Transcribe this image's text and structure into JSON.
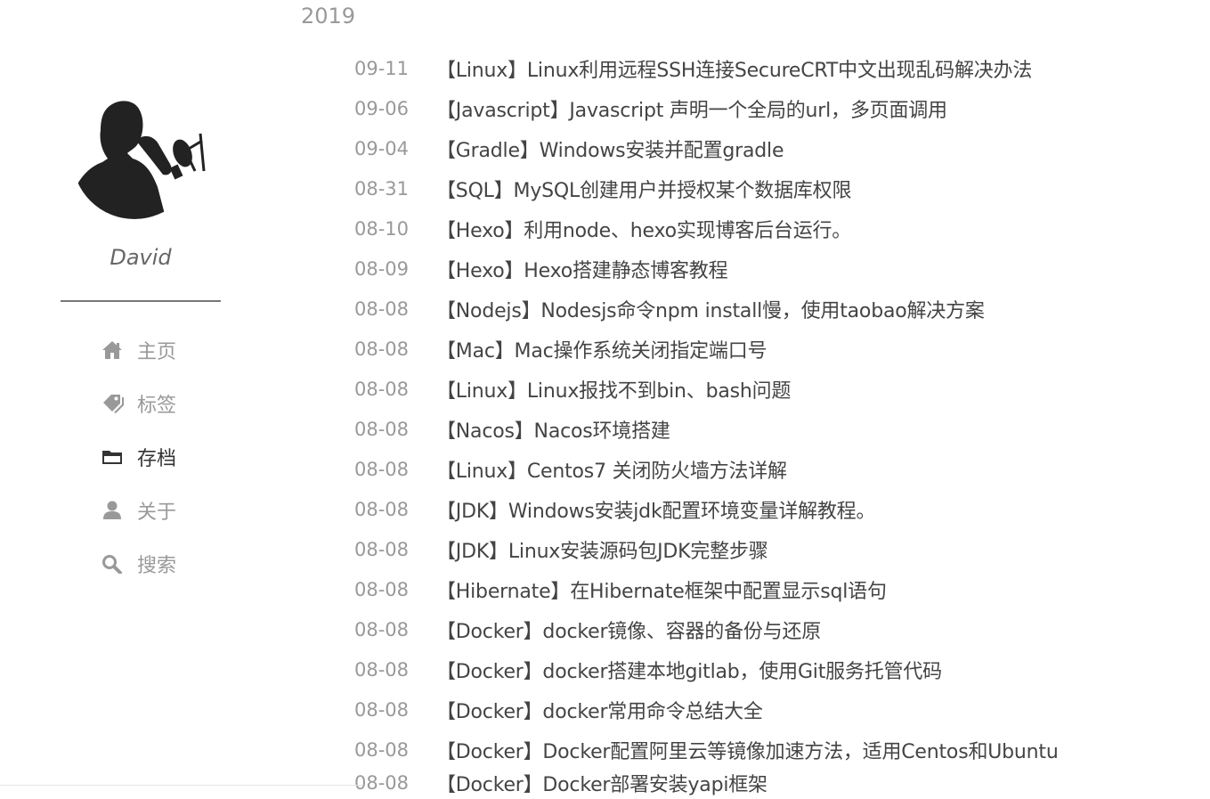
{
  "sidebar": {
    "author": "David",
    "nav": [
      {
        "label": "主页",
        "icon": "home-icon",
        "active": false
      },
      {
        "label": "标签",
        "icon": "tag-icon",
        "active": false
      },
      {
        "label": "存档",
        "icon": "archive-folder-icon",
        "active": true
      },
      {
        "label": "关于",
        "icon": "user-icon",
        "active": false
      },
      {
        "label": "搜索",
        "icon": "search-icon",
        "active": false
      }
    ]
  },
  "archive": {
    "year": "2019",
    "posts": [
      {
        "date": "09-11",
        "title": "【Linux】Linux利用远程SSH连接SecureCRT中文出现乱码解决办法"
      },
      {
        "date": "09-06",
        "title": "【Javascript】Javascript 声明一个全局的url，多页面调用"
      },
      {
        "date": "09-04",
        "title": "【Gradle】Windows安装并配置gradle"
      },
      {
        "date": "08-31",
        "title": "【SQL】MySQL创建用户并授权某个数据库权限"
      },
      {
        "date": "08-10",
        "title": "【Hexo】利用node、hexo实现博客后台运行。"
      },
      {
        "date": "08-09",
        "title": "【Hexo】Hexo搭建静态博客教程"
      },
      {
        "date": "08-08",
        "title": "【Nodejs】Nodesjs命令npm install慢，使用taobao解决方案"
      },
      {
        "date": "08-08",
        "title": "【Mac】Mac操作系统关闭指定端口号"
      },
      {
        "date": "08-08",
        "title": "【Linux】Linux报找不到bin、bash问题"
      },
      {
        "date": "08-08",
        "title": "【Nacos】Nacos环境搭建"
      },
      {
        "date": "08-08",
        "title": "【Linux】Centos7 关闭防火墙方法详解"
      },
      {
        "date": "08-08",
        "title": "【JDK】Windows安装jdk配置环境变量详解教程。"
      },
      {
        "date": "08-08",
        "title": "【JDK】Linux安装源码包JDK完整步骤"
      },
      {
        "date": "08-08",
        "title": "【Hibernate】在Hibernate框架中配置显示sql语句"
      },
      {
        "date": "08-08",
        "title": "【Docker】docker镜像、容器的备份与还原"
      },
      {
        "date": "08-08",
        "title": "【Docker】docker搭建本地gitlab，使用Git服务托管代码"
      },
      {
        "date": "08-08",
        "title": "【Docker】docker常用命令总结大全"
      },
      {
        "date": "08-08",
        "title": "【Docker】Docker配置阿里云等镜像加速方法，适用Centos和Ubuntu"
      },
      {
        "date": "08-08",
        "title": "【Docker】Docker部署安装yapi框架"
      }
    ]
  }
}
